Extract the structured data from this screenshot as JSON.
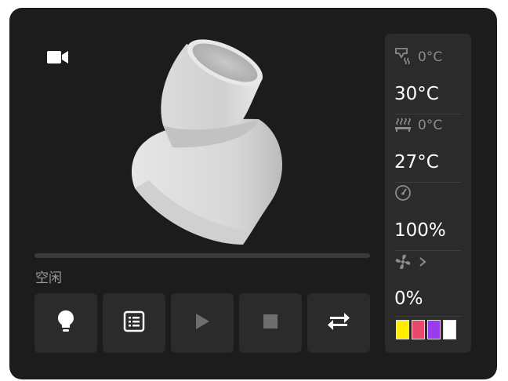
{
  "status": {
    "label": "空闲"
  },
  "progress": {
    "fraction": 0
  },
  "panel": {
    "nozzle_target": "0°C",
    "nozzle_current": "30°C",
    "bed_target": "0°C",
    "bed_current": "27°C",
    "speed": "100%",
    "fan": "0%"
  },
  "buttons": [
    {
      "name": "light-button",
      "icon": "lightbulb-icon"
    },
    {
      "name": "files-button",
      "icon": "list-icon"
    },
    {
      "name": "play-button",
      "icon": "play-icon"
    },
    {
      "name": "stop-button",
      "icon": "stop-icon"
    },
    {
      "name": "swap-button",
      "icon": "swap-icon"
    }
  ],
  "filament_colors": [
    "#ffee00",
    "#e8496b",
    "#9b3bf0",
    "#ffffff"
  ]
}
